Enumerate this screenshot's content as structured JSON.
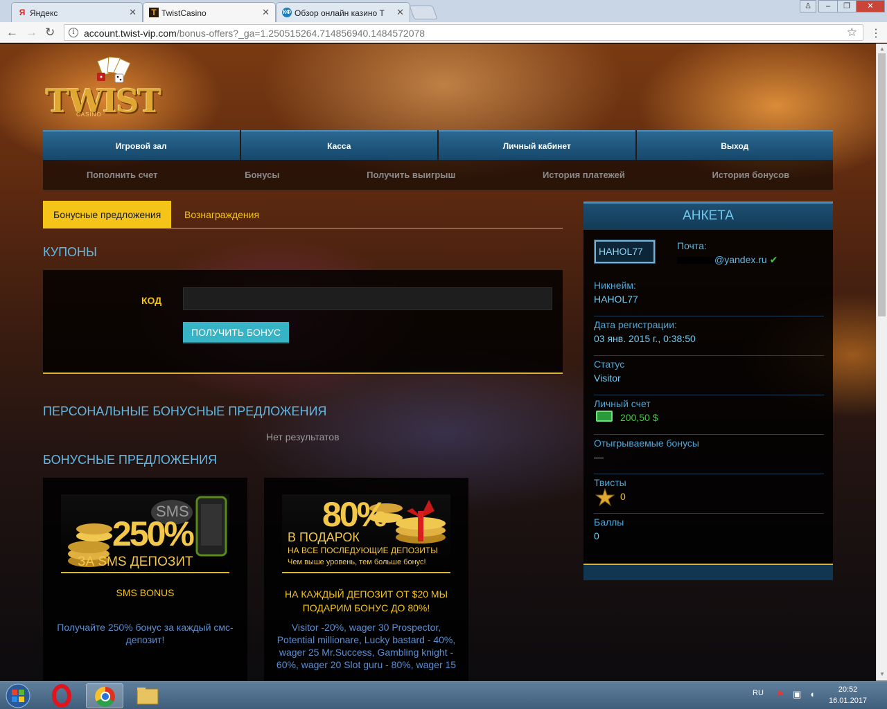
{
  "browser": {
    "tabs": [
      {
        "label": "Яндекс",
        "icon": "yandex-icon",
        "favicon": "Я"
      },
      {
        "label": "TwistCasino",
        "icon": "twist-favicon",
        "favicon": "T"
      },
      {
        "label": "Обзор онлайн казино T",
        "icon": "kf-favicon",
        "favicon": "КФ"
      }
    ],
    "url_host": "account.twist-vip.com",
    "url_path": "/bonus-offers?_ga=1.250515264.714856940.1484572078"
  },
  "logo": {
    "word": "TWIST",
    "sub": "CASINO"
  },
  "mainnav": [
    "Игровой зал",
    "Касса",
    "Личный кабинет",
    "Выход"
  ],
  "subnav": [
    "Пополнить счет",
    "Бонусы",
    "Получить выигрыш",
    "История платежей",
    "История бонусов"
  ],
  "tabs": {
    "active": "Бонусные предложения",
    "inactive": "Вознаграждения"
  },
  "coupons": {
    "title": "КУПОНЫ",
    "code_label": "КОД",
    "code_value": "",
    "button": "ПОЛУЧИТЬ БОНУС"
  },
  "personal": {
    "title": "ПЕРСОНАЛЬНЫЕ БОНУСНЫЕ ПРЕДЛОЖЕНИЯ",
    "empty": "Нет результатов"
  },
  "offers": {
    "title": "БОНУСНЫЕ ПРЕДЛОЖЕНИЯ",
    "cards": [
      {
        "banner_big": "250%",
        "banner_sms": "SMS",
        "banner_sub": "ЗА SMS ДЕПОЗИТ",
        "title": "SMS BONUS",
        "desc": "Получайте 250% бонус за каждый смс-депозит!"
      },
      {
        "banner_big": "80%",
        "banner_l1": "В ПОДАРОК",
        "banner_l2": "НА ВСЕ ПОСЛЕДУЮЩИЕ ДЕПОЗИТЫ",
        "banner_l3": "Чем выше уровень, тем больше бонус!",
        "title": "НА КАЖДЫЙ ДЕПОЗИТ ОТ $20 МЫ ПОДАРИМ БОНУС ДО 80%!",
        "desc": "Visitor -20%, wager 30 Prospector, Potential millionare, Lucky bastard - 40%, wager 25 Mr.Success, Gambling knight - 60%, wager 20 Slot guru - 80%, wager 15"
      }
    ]
  },
  "profile": {
    "title": "АНКЕТА",
    "avatar_alt": "HAHOL77",
    "mail_label": "Почта:",
    "mail_value": "@yandex.ru",
    "check": "✔",
    "rows": [
      {
        "k": "Никнейм:",
        "v": "HAHOL77"
      },
      {
        "k": "Дата регистрации:",
        "v": "03 янв. 2015 г., 0:38:50"
      },
      {
        "k": "Статус",
        "v": "Visitor"
      },
      {
        "k": "Личный счет",
        "v": "200,50 $"
      },
      {
        "k": "Отыгрываемые бонусы",
        "v": "—"
      },
      {
        "k": "Твисты",
        "v": "0"
      },
      {
        "k": "Баллы",
        "v": "0"
      }
    ]
  },
  "taskbar": {
    "lang": "RU",
    "time": "20:52",
    "date": "16.01.2017"
  }
}
